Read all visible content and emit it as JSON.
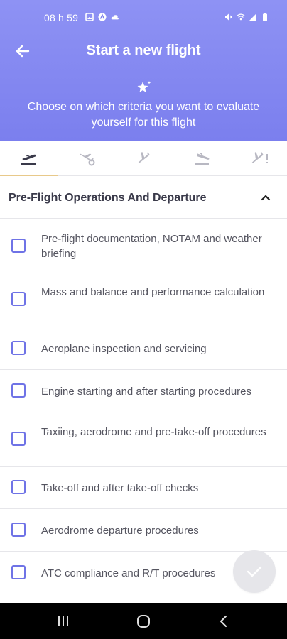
{
  "status_bar": {
    "time": "08 h 59",
    "left_icons": [
      "image-icon",
      "app-icon",
      "cloud-icon"
    ],
    "right_icons": [
      "mute-icon",
      "wifi-icon",
      "signal-icon",
      "battery-icon"
    ]
  },
  "header": {
    "title": "Start a new flight",
    "back_icon": "arrow-left-icon",
    "star_icon": "sparkle-icon",
    "subtitle": "Choose on which criteria you want to evaluate yourself for this flight",
    "background": "#7e82f0"
  },
  "tabs": [
    {
      "icon": "departure-icon",
      "active": true
    },
    {
      "icon": "plane-gear-icon",
      "active": false
    },
    {
      "icon": "plane-icon",
      "active": false
    },
    {
      "icon": "arrival-icon",
      "active": false
    },
    {
      "icon": "plane-alert-icon",
      "active": false
    }
  ],
  "section": {
    "title": "Pre-Flight Operations And Departure",
    "expanded": true
  },
  "criteria": [
    {
      "label": "Pre-flight documentation, NOTAM and weather briefing",
      "checked": false
    },
    {
      "label": "Mass and balance and performance calculation",
      "checked": false
    },
    {
      "label": "Aeroplane inspection and servicing",
      "checked": false
    },
    {
      "label": "Engine starting and after starting procedures",
      "checked": false
    },
    {
      "label": "Taxiing, aerodrome and pre-take-off procedures",
      "checked": false
    },
    {
      "label": "Take-off and after take-off checks",
      "checked": false
    },
    {
      "label": "Aerodrome departure procedures",
      "checked": false
    },
    {
      "label": "ATC compliance and R/T procedures",
      "checked": false
    }
  ],
  "fab": {
    "icon": "check-icon"
  },
  "nav_bar": {
    "buttons": [
      "recents-icon",
      "home-icon",
      "back-icon"
    ]
  },
  "colors": {
    "accent": "#6f73e6",
    "tab_indicator": "#e8c98a"
  }
}
